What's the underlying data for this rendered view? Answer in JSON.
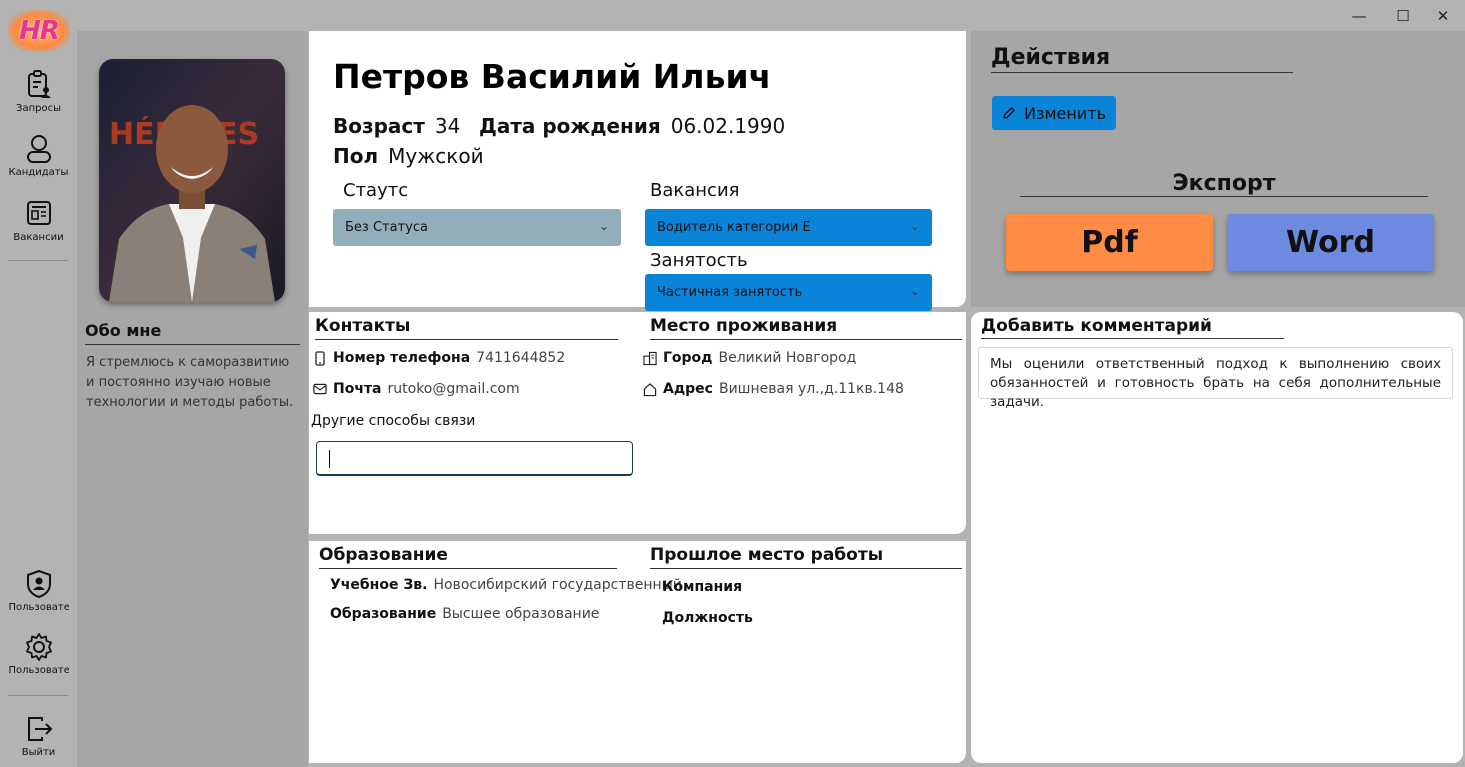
{
  "app": {
    "logo_text": "HR"
  },
  "window_controls": {
    "minimize": "—",
    "maximize": "☐",
    "close": "✕"
  },
  "nav": {
    "items": [
      {
        "label": "Запросы",
        "icon": "requests-icon"
      },
      {
        "label": "Кандидаты",
        "icon": "candidates-icon"
      },
      {
        "label": "Вакансии",
        "icon": "vacancies-icon"
      },
      {
        "label": "Пользователи",
        "icon": "user-shield-icon"
      },
      {
        "label": "Пользователи",
        "icon": "settings-gear-icon"
      },
      {
        "label": "Выйти",
        "icon": "logout-icon"
      }
    ]
  },
  "about": {
    "title": "Обо мне",
    "text": "Я стремлюсь к саморазвитию и постоянно изучаю новые технологии и методы работы."
  },
  "profile": {
    "name": "Петров Василий Ильич",
    "age_label": "Возраст",
    "age": "34",
    "birth_label": "Дата рождения",
    "birth_date": "06.02.1990",
    "gender_label": "Пол",
    "gender": "Мужской",
    "status_label": "Стаутс",
    "status_value": "Без Статуса",
    "vacancy_label": "Вакансия",
    "vacancy_value": "Водитель категории Е",
    "employment_label": "Занятость",
    "employment_value": "Частичная занятость"
  },
  "contacts": {
    "title": "Контакты",
    "phone_label": "Номер телефона",
    "phone": "7411644852",
    "email_label": "Почта",
    "email": "rutoko@gmail.com",
    "other_label": "Другие способы связи",
    "other_value": ""
  },
  "residence": {
    "title": "Место проживания",
    "city_label": "Город",
    "city": "Великий Новгород",
    "address_label": "Адрес",
    "address": "Вишневая ул.,д.11кв.148"
  },
  "education": {
    "title": "Образование",
    "institution_label": "Учебное Зв.",
    "institution": "Новосибирский государственный",
    "level_label": "Образование",
    "level": "Высшее образование"
  },
  "previous_job": {
    "title": "Прошлое место работы",
    "company_label": "Компания",
    "position_label": "Должность"
  },
  "actions": {
    "title": "Действия",
    "edit_label": "Изменить",
    "export_title": "Экспорт",
    "pdf_label": "Pdf",
    "word_label": "Word"
  },
  "comment": {
    "title": "Добавить комментарий",
    "text": "Мы оценили ответственный подход к выполнению своих обязанностей и готовность брать на себя дополнительные задачи."
  },
  "colors": {
    "accent_blue": "#0a84d8",
    "status_gray": "#93aebb",
    "pdf_orange": "#ff8c45",
    "word_blue": "#6b8ae0",
    "logo_pink": "#e8358f"
  }
}
